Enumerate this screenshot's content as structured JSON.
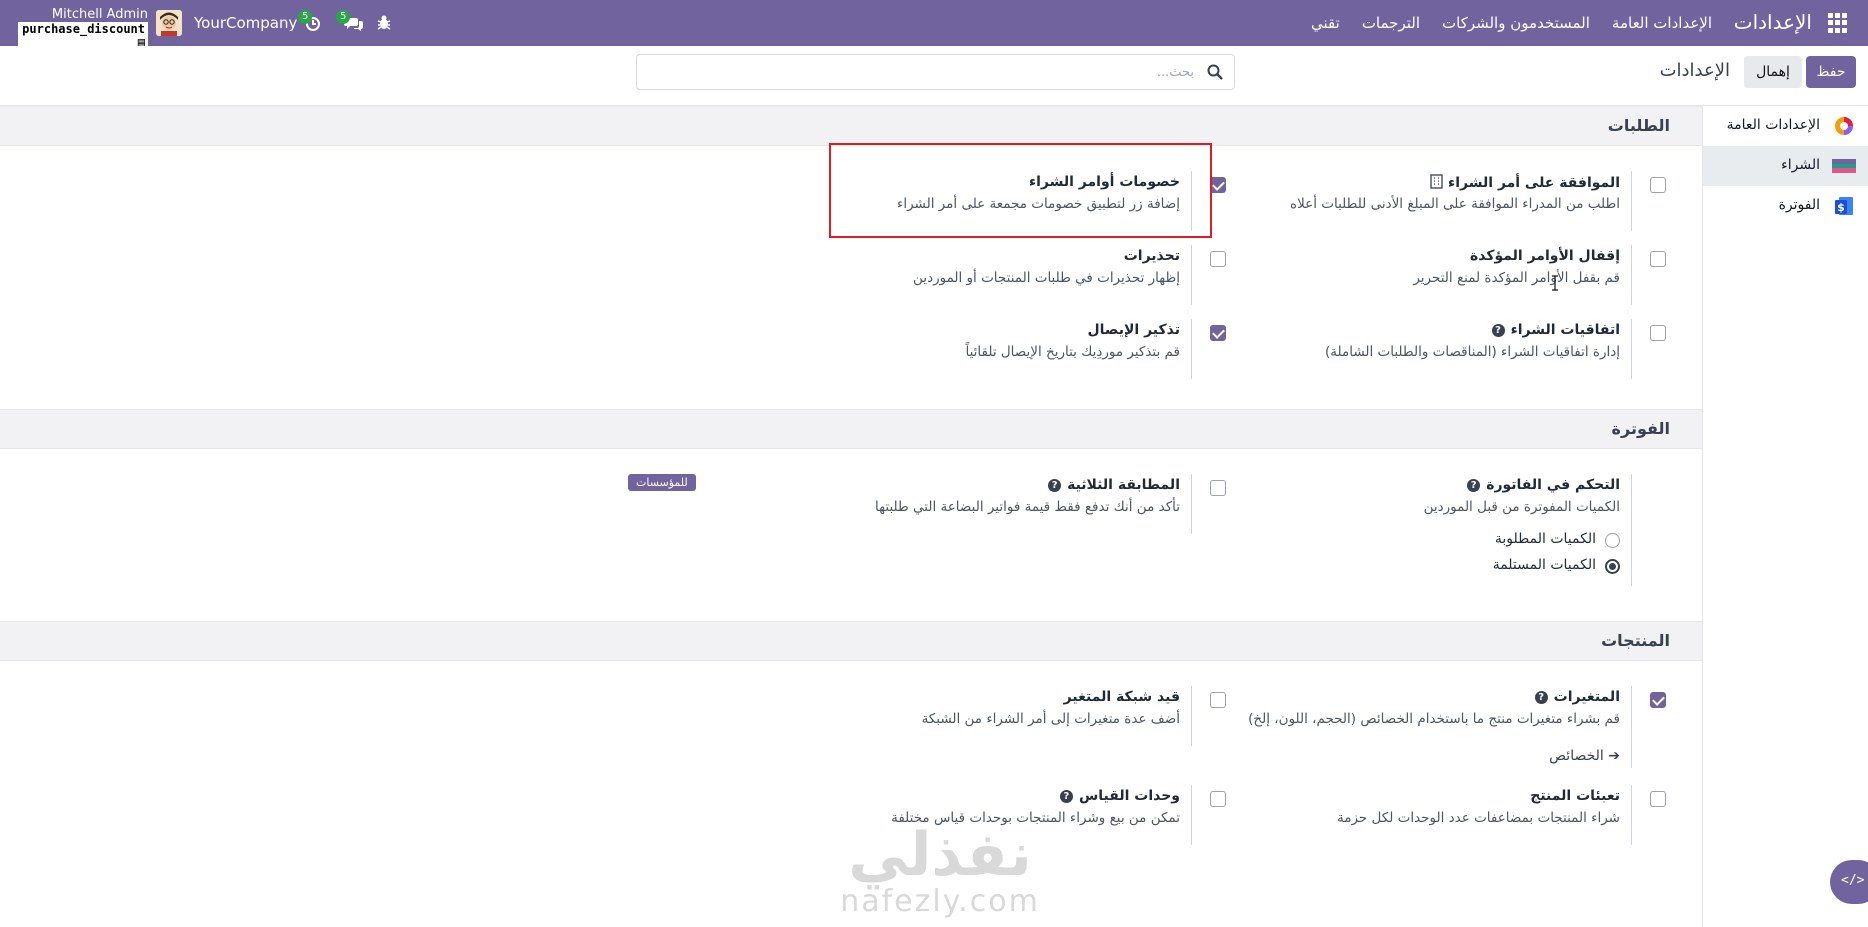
{
  "navbar": {
    "brand": "الإعدادات",
    "menu": [
      "الإعدادات العامة",
      "المستخدمون والشركات",
      "الترجمات",
      "تقني"
    ],
    "user_name": "Mitchell Admin",
    "db_name": "purchase_discount",
    "company": "YourCompany",
    "activity_count": "5",
    "messages_count": "5",
    "icons": [
      "apps-grid-icon",
      "clock-icon",
      "chat-icon",
      "bug-icon",
      "avatar"
    ]
  },
  "control_panel": {
    "save_label": "حفظ",
    "discard_label": "إهمال",
    "title": "الإعدادات",
    "search_placeholder": "بحث..."
  },
  "sidebar": {
    "items": [
      {
        "label": "الإعدادات العامة",
        "icon": "odoo-logo-icon",
        "active": false
      },
      {
        "label": "الشراء",
        "icon": "purchase-icon",
        "active": true
      },
      {
        "label": "الفوترة",
        "icon": "invoicing-icon",
        "active": false
      }
    ]
  },
  "sections": {
    "orders": {
      "title": "الطلبات",
      "po_approval": {
        "title": "الموافقة على أمر الشراء",
        "desc": "اطلب من المدراء الموافقة على المبلغ الأدنى للطلبات أعلاه",
        "checked": false
      },
      "po_discounts": {
        "title": "خصومات أوامر الشراء",
        "desc": "إضافة زر لتطبيق خصومات مجمعة على أمر الشراء",
        "checked": true
      },
      "lock_orders": {
        "title": "إقفال الأوامر المؤكدة",
        "desc": "قم بقفل الأوامر المؤكدة لمنع التحرير",
        "checked": false
      },
      "warnings": {
        "title": "تحذيرات",
        "desc": "إظهار تحذيرات في طلبات المنتجات أو الموردين",
        "checked": false
      },
      "agreements": {
        "title": "اتفاقيات الشراء",
        "desc": "إدارة اتفاقيات الشراء (المناقصات والطلبات الشاملة)",
        "checked": false
      },
      "receipt_reminder": {
        "title": "تذكير الإيصال",
        "desc": "قم بتذكير موردِيك بتاريخ الإيصال تلقائياً",
        "checked": true
      }
    },
    "invoicing": {
      "title": "الفوترة",
      "bill_control": {
        "title": "التحكم في الفاتورة",
        "desc": "الكميات المفوترة من قبل الموردين",
        "options": [
          "الكميات المطلوبة",
          "الكميات المستلمة"
        ],
        "selected": 1
      },
      "three_way": {
        "title": "المطابقة الثلاثية",
        "desc": "تأكد من أنك تدفع فقط قيمة فواتير البضاعة التي طلبتها",
        "badge": "للمؤسسات",
        "checked": false
      }
    },
    "products": {
      "title": "المنتجات",
      "variants": {
        "title": "المتغيرات",
        "desc": "قم بشراء متغيرات منتج ما باستخدام الخصائص (الحجم، اللون، إلخ)",
        "link": "الخصائص",
        "checked": true
      },
      "variant_grid": {
        "title": "قيد شبكة المتغير",
        "desc": "أضف عدة متغيرات إلى أمر الشراء من الشبكة",
        "checked": false
      },
      "packagings": {
        "title": "تعبئات المنتج",
        "desc": "شراء المنتجات بمضاعفات عدد الوحدات لكل حزمة",
        "checked": false
      },
      "uom": {
        "title": "وحدات القياس",
        "desc": "تمكن من بيع وشراء المنتجات بوحدات قياس مختلفة",
        "checked": false
      }
    }
  },
  "watermark": {
    "ar": "نفذلي",
    "en": "nafezly.com"
  },
  "colors": {
    "brand": "#71639e",
    "highlight": "#e11d24",
    "section_bg": "#f2f2f4"
  }
}
